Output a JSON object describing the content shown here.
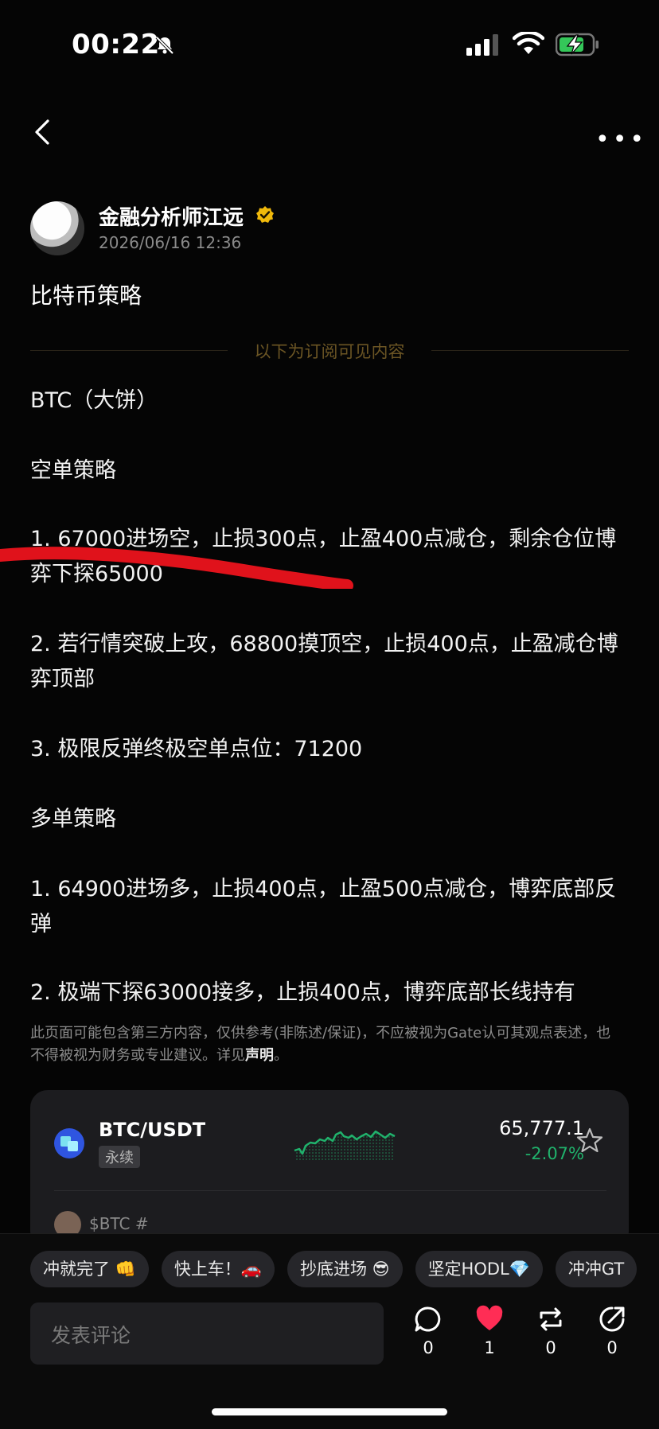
{
  "status_bar": {
    "time": "00:22",
    "icons": [
      "bell-slash-icon",
      "signal-icon",
      "wifi-icon",
      "battery-charging-icon"
    ]
  },
  "nav": {
    "icons": [
      "back-icon",
      "more-icon"
    ]
  },
  "author": {
    "name": "金融分析师江远",
    "date": "2026/06/16 12:36",
    "verified_icon": "verified-badge-icon"
  },
  "post": {
    "title": "比特币策略",
    "divider_text": "以下为订阅可见内容",
    "paragraphs": [
      "BTC（大饼）",
      "空单策略",
      "1. 67000进场空，止损300点，止盈400点减仓，剩余仓位博弈下探65000",
      "2. 若行情突破上攻，68800摸顶空，止损400点，止盈减仓博弈顶部",
      "3. 极限反弹终极空单点位：71200",
      "多单策略",
      "1. 64900进场多，止损400点，止盈500点减仓，博弈底部反弹",
      "2. 极端下探63000接多，止损400点，博弈底部长线持有"
    ]
  },
  "disclaimer": {
    "text": "此页面可能包含第三方内容，仅供参考(非陈述/保证)，不应被视为Gate认可其观点表述，也不得被视为财务或专业建议。详见",
    "link": "声明",
    "end": "。"
  },
  "ticker": {
    "pair": "BTC/USDT",
    "tag": "永续",
    "price": "65,777.1",
    "change": "-2.07%",
    "hashtag": "$BTC #",
    "up_color": "#20b26c"
  },
  "chips": [
    "冲就完了 👊",
    "快上车！🚗",
    "抄底进场 😎",
    "坚定HODL💎",
    "冲冲GT"
  ],
  "comment": {
    "placeholder": "发表评论"
  },
  "actions": [
    {
      "icon": "comment-icon",
      "count": "0"
    },
    {
      "icon": "heart-icon",
      "count": "1"
    },
    {
      "icon": "repost-icon",
      "count": "0"
    },
    {
      "icon": "share-icon",
      "count": "0"
    }
  ],
  "colors": {
    "background": "#050505",
    "accent_gold": "#6b5524",
    "like_red": "#ff2d55",
    "annotation_red": "#e0121b"
  }
}
